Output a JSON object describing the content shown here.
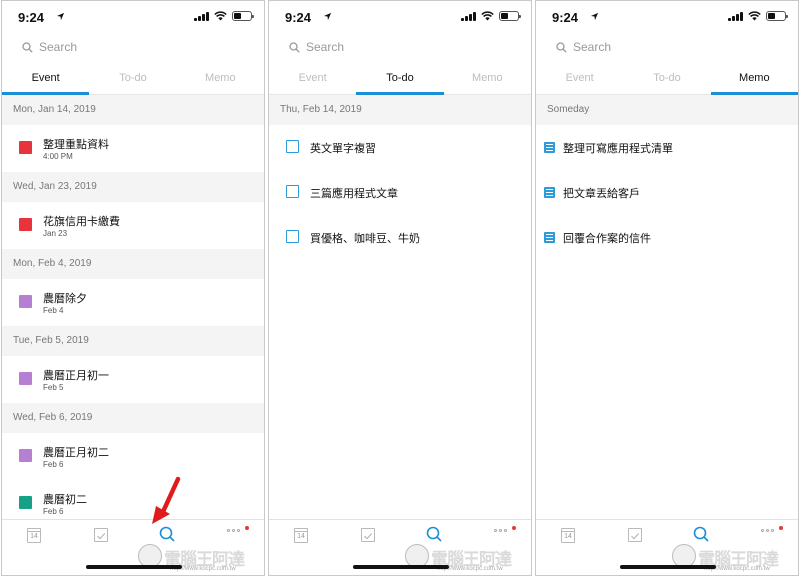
{
  "status": {
    "time": "9:24"
  },
  "search": {
    "placeholder": "Search"
  },
  "tabs": [
    "Event",
    "To-do",
    "Memo"
  ],
  "panels": [
    {
      "active_tab": "Event",
      "groups": [
        {
          "date": "Mon, Jan 14, 2019",
          "items": [
            {
              "title": "整理重點資料",
              "sub": "4:00 PM",
              "color": "#e8323c"
            }
          ]
        },
        {
          "date": "Wed, Jan 23, 2019",
          "items": [
            {
              "title": "花旗信用卡繳費",
              "sub": "Jan 23",
              "color": "#e8323c"
            }
          ]
        },
        {
          "date": "Mon, Feb 4, 2019",
          "items": [
            {
              "title": "農曆除夕",
              "sub": "Feb 4",
              "color": "#b77fd1"
            }
          ]
        },
        {
          "date": "Tue, Feb 5, 2019",
          "items": [
            {
              "title": "農曆正月初一",
              "sub": "Feb 5",
              "color": "#b77fd1"
            }
          ]
        },
        {
          "date": "Wed, Feb 6, 2019",
          "items": [
            {
              "title": "農曆正月初二",
              "sub": "Feb 6",
              "color": "#b77fd1"
            },
            {
              "title": "農曆初二",
              "sub": "Feb 6",
              "color": "#16a085"
            }
          ]
        }
      ]
    },
    {
      "active_tab": "To-do",
      "date": "Thu, Feb 14, 2019",
      "items": [
        "英文單字複習",
        "三篇應用程式文章",
        "買優格、咖啡豆、牛奶"
      ]
    },
    {
      "active_tab": "Memo",
      "date": "Someday",
      "items": [
        "整理可寫應用程式清單",
        "把文章丟給客戶",
        "回覆合作案的信件"
      ]
    }
  ],
  "bottom_nav": {
    "calendar_day": "14",
    "items": [
      "calendar-icon",
      "checkbox-icon",
      "search-icon",
      "more-icon"
    ]
  },
  "watermark": {
    "brand": "電腦王阿達",
    "url": "http://www.kocpc.com.tw"
  },
  "colors": {
    "accent": "#1b8fd6",
    "arrow": "#e01b1b"
  }
}
